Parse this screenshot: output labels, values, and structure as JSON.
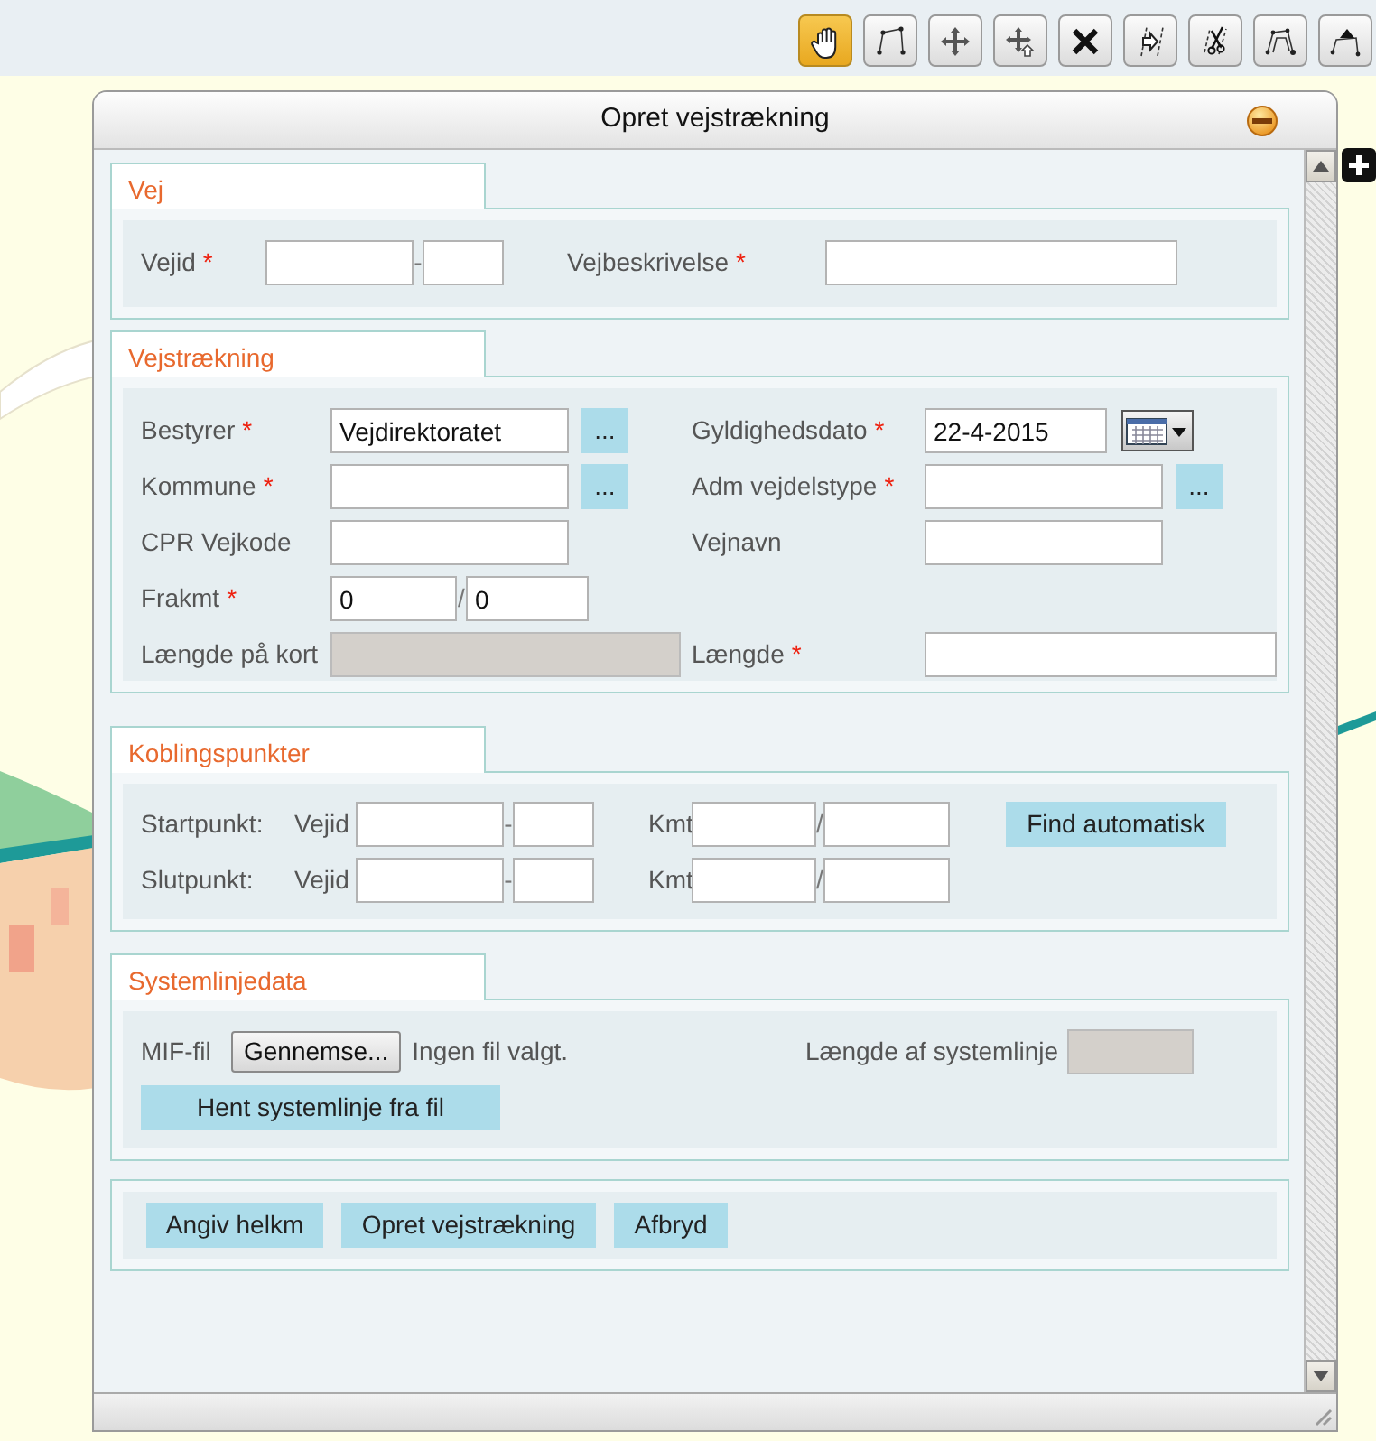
{
  "window": {
    "title": "Opret vejstrækning"
  },
  "toolbar": [
    {
      "kind": "pan",
      "selected": true
    },
    {
      "kind": "draw-line",
      "selected": false
    },
    {
      "kind": "move",
      "selected": false
    },
    {
      "kind": "move-point",
      "selected": false
    },
    {
      "kind": "delete",
      "selected": false
    },
    {
      "kind": "offset",
      "selected": false
    },
    {
      "kind": "split",
      "selected": false
    },
    {
      "kind": "edit-vertices",
      "selected": false
    },
    {
      "kind": "add-vertex",
      "selected": false
    }
  ],
  "sections": [
    {
      "title": "Vej",
      "rows": [
        [
          {
            "kind": "label",
            "text": "Vejid",
            "mark": "*"
          },
          {
            "kind": "input",
            "disabled": false
          },
          {
            "kind": "sep",
            "text": "-"
          },
          {
            "kind": "input",
            "disabled": false
          },
          {
            "kind": "label",
            "text": "Vejbeskrivelse",
            "mark": "*"
          },
          {
            "kind": "input",
            "disabled": false
          }
        ]
      ]
    },
    {
      "title": "Vejstrækning",
      "rows": [
        [
          {
            "kind": "label",
            "text": "Bestyrer",
            "mark": "*"
          },
          {
            "kind": "input",
            "value": "Vejdirektoratet",
            "disabled": false
          },
          {
            "kind": "button",
            "text": "..."
          },
          {
            "kind": "label",
            "text": "Gyldighedsdato",
            "mark": "*"
          },
          {
            "kind": "input",
            "value": "22-4-2015",
            "disabled": false
          },
          {
            "kind": "calendar"
          }
        ],
        [
          {
            "kind": "label",
            "text": "Kommune",
            "mark": "*"
          },
          {
            "kind": "input",
            "disabled": false
          },
          {
            "kind": "button",
            "text": "..."
          },
          {
            "kind": "label",
            "text": "Adm vejdelstype",
            "mark": "*"
          },
          {
            "kind": "input",
            "disabled": false
          },
          {
            "kind": "button",
            "text": "..."
          }
        ],
        [
          {
            "kind": "label",
            "text": "CPR Vejkode"
          },
          {
            "kind": "input",
            "disabled": false
          },
          {
            "kind": "label",
            "text": "Vejnavn"
          },
          {
            "kind": "input",
            "disabled": false
          }
        ],
        [
          {
            "kind": "label",
            "text": "Frakmt",
            "mark": "*"
          },
          {
            "kind": "range",
            "from": {
              "value": "0",
              "disabled": false
            },
            "sep": "/",
            "to": {
              "value": "0",
              "disabled": false
            }
          }
        ],
        [
          {
            "kind": "label",
            "text": "Længde på kort"
          },
          {
            "kind": "input",
            "disabled": true
          },
          {
            "kind": "label",
            "text": "Længde",
            "mark": "*"
          },
          {
            "kind": "input",
            "disabled": false
          }
        ]
      ]
    },
    {
      "title": "Koblingspunkter",
      "rows": [
        [
          {
            "kind": "label",
            "text": "Startpunkt:"
          },
          {
            "kind": "label",
            "text": "Vejid"
          },
          {
            "kind": "input",
            "disabled": false
          },
          {
            "kind": "sep",
            "text": "-"
          },
          {
            "kind": "input",
            "disabled": false
          },
          {
            "kind": "label",
            "text": "Kmt"
          },
          {
            "kind": "input",
            "disabled": false
          },
          {
            "kind": "sep",
            "text": "/"
          },
          {
            "kind": "input",
            "disabled": false
          },
          {
            "kind": "button",
            "text": "Find automatisk"
          }
        ],
        [
          {
            "kind": "label",
            "text": "Slutpunkt:"
          },
          {
            "kind": "label",
            "text": "Vejid"
          },
          {
            "kind": "input",
            "disabled": false
          },
          {
            "kind": "sep",
            "text": "-"
          },
          {
            "kind": "input",
            "disabled": false
          },
          {
            "kind": "label",
            "text": "Kmt"
          },
          {
            "kind": "input",
            "disabled": false
          },
          {
            "kind": "sep",
            "text": "/"
          },
          {
            "kind": "input",
            "disabled": false
          }
        ]
      ]
    },
    {
      "title": "Systemlinjedata",
      "rows": [
        [
          {
            "kind": "label",
            "text": "MIF-fil"
          },
          {
            "kind": "file",
            "button": "Gennemse...",
            "text": "Ingen fil valgt."
          },
          {
            "kind": "label",
            "text": "Længde af systemlinje"
          },
          {
            "kind": "input",
            "disabled": true
          }
        ],
        [
          {
            "kind": "button",
            "text": "Hent systemlinje fra fil"
          }
        ]
      ]
    },
    {
      "rows": [
        [
          {
            "kind": "button",
            "text": "Angiv helkm"
          },
          {
            "kind": "button",
            "text": "Opret vejstrækning"
          },
          {
            "kind": "button",
            "text": "Afbryd"
          }
        ]
      ]
    }
  ]
}
